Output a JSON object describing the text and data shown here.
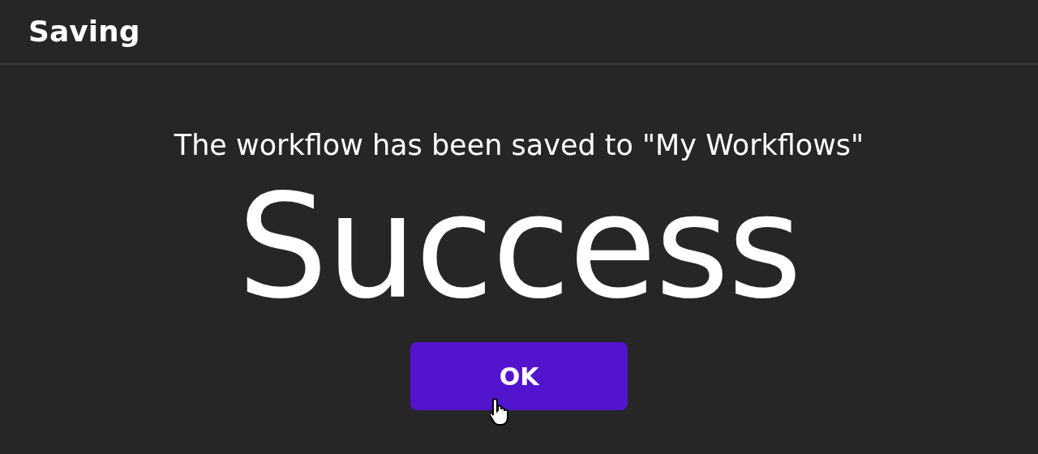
{
  "dialog": {
    "title": "Saving",
    "message": "The workflow has been saved to \"My Workflows\"",
    "headline": "Success",
    "buttons": [
      {
        "label": "OK",
        "kind": "primary"
      }
    ]
  }
}
